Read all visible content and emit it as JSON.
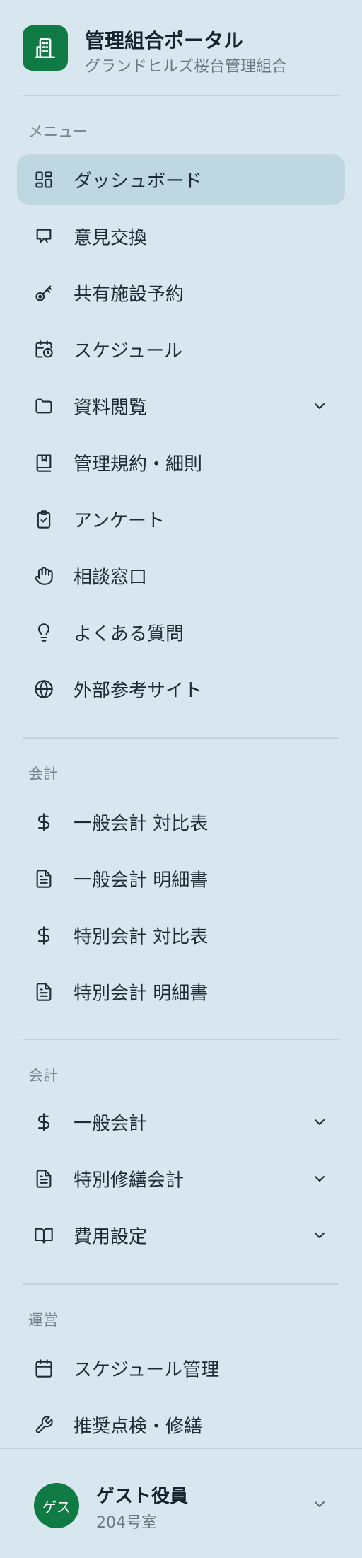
{
  "app": {
    "title": "管理組合ポータル",
    "subtitle": "グランドヒルズ桜台管理組合",
    "logo_icon": "building-icon",
    "accent_color": "#0f7a44"
  },
  "sections": {
    "menu": {
      "label": "メニュー",
      "items": [
        {
          "label": "ダッシュボード",
          "icon": "dashboard-grid-icon",
          "active": true
        },
        {
          "label": "意見交換",
          "icon": "chat-bubble-icon"
        },
        {
          "label": "共有施設予約",
          "icon": "key-icon"
        },
        {
          "label": "スケジュール",
          "icon": "calendar-clock-icon"
        },
        {
          "label": "資料閲覧",
          "icon": "folder-icon",
          "expandable": true
        },
        {
          "label": "管理規約・細則",
          "icon": "bookmark-book-icon"
        },
        {
          "label": "アンケート",
          "icon": "clipboard-check-icon"
        },
        {
          "label": "相談窓口",
          "icon": "hand-icon"
        },
        {
          "label": "よくある質問",
          "icon": "lightbulb-icon"
        },
        {
          "label": "外部参考サイト",
          "icon": "globe-icon"
        }
      ]
    },
    "accounting1": {
      "label": "会計",
      "items": [
        {
          "label": "一般会計 対比表",
          "icon": "dollar-icon"
        },
        {
          "label": "一般会計 明細書",
          "icon": "document-icon"
        },
        {
          "label": "特別会計 対比表",
          "icon": "dollar-icon"
        },
        {
          "label": "特別会計 明細書",
          "icon": "document-icon"
        }
      ]
    },
    "accounting2": {
      "label": "会計",
      "items": [
        {
          "label": "一般会計",
          "icon": "dollar-icon",
          "expandable": true
        },
        {
          "label": "特別修繕会計",
          "icon": "document-icon",
          "expandable": true
        },
        {
          "label": "費用設定",
          "icon": "open-book-icon",
          "expandable": true
        }
      ]
    },
    "operations": {
      "label": "運営",
      "items": [
        {
          "label": "スケジュール管理",
          "icon": "calendar-icon"
        },
        {
          "label": "推奨点検・修繕",
          "icon": "wrench-icon"
        }
      ]
    }
  },
  "user": {
    "avatar_text": "ゲス",
    "name": "ゲスト役員",
    "room": "204号室"
  }
}
